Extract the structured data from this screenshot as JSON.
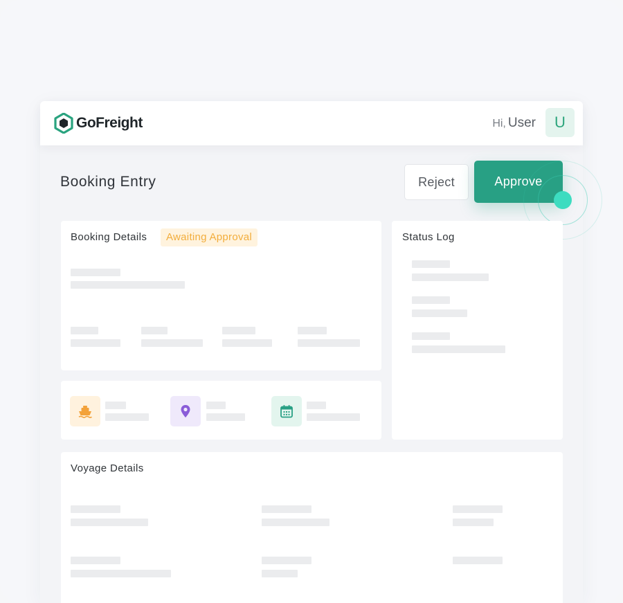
{
  "app": {
    "brand": "GoFreight"
  },
  "header": {
    "greeting": "Hi,",
    "user_name": "User",
    "avatar_initial": "U"
  },
  "page": {
    "title": "Booking Entry"
  },
  "actions": {
    "reject_label": "Reject",
    "approve_label": "Approve"
  },
  "booking_details": {
    "title": "Booking Details",
    "status": "Awaiting Approval"
  },
  "status_log": {
    "title": "Status Log"
  },
  "voyage_details": {
    "title": "Voyage Details"
  },
  "summary_icons": [
    {
      "icon": "ship-icon",
      "color": "#f3a23a",
      "bg": "#fff2de"
    },
    {
      "icon": "location-pin-icon",
      "color": "#8a5cd8",
      "bg": "#efe9fb"
    },
    {
      "icon": "calendar-icon",
      "color": "#28a084",
      "bg": "#e3f5ee"
    }
  ],
  "colors": {
    "accent": "#28a084",
    "accent_highlight": "#3ddcc0",
    "status_badge_bg": "#fff3de",
    "status_badge_text": "#f2ad3c"
  }
}
